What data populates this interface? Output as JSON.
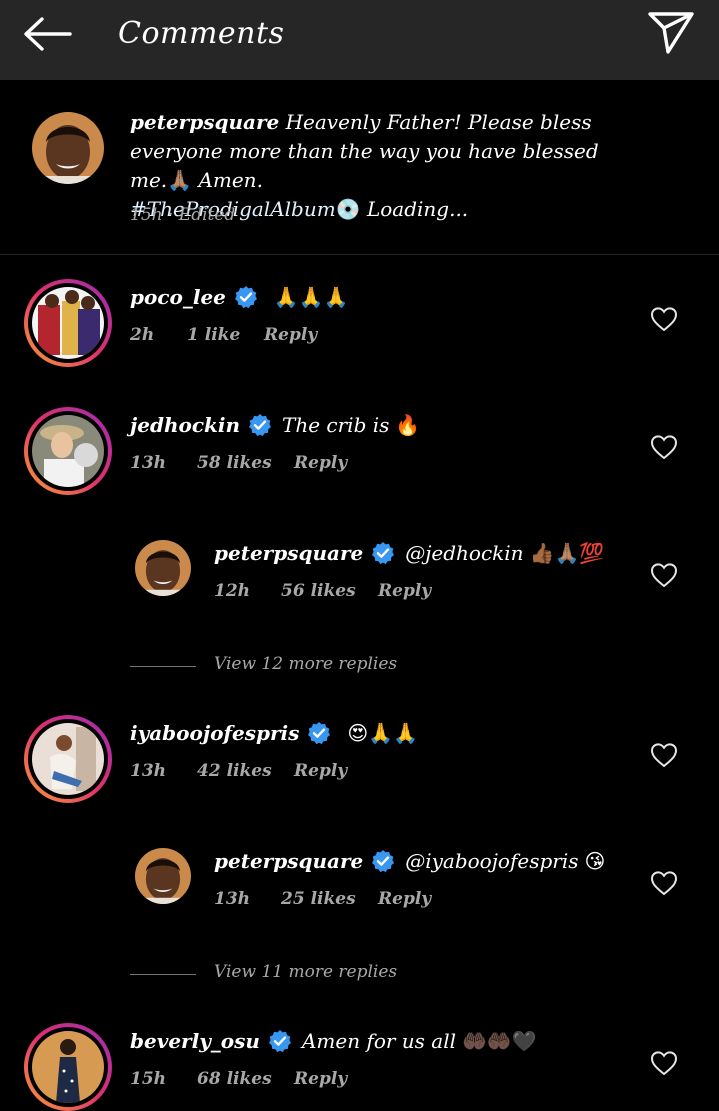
{
  "header": {
    "title": "Comments"
  },
  "caption": {
    "username": "peterpsquare",
    "text_1": "Heavenly Father! Please bless everyone",
    "text_2": "more than the way you have blessed me.",
    "emoji_pray": "🙏🏽",
    "text_amen": "Amen.",
    "hashtag": "#TheProdigalAlbum",
    "emoji_disc": "💿",
    "text_loading": "Loading...",
    "meta": "15h · Edited"
  },
  "comments": [
    {
      "username": "poco_lee",
      "text": "",
      "emoji": "🙏🙏🙏",
      "time": "2h",
      "likes": "1 like",
      "reply": "Reply"
    },
    {
      "username": "jedhockin",
      "text": "The crib is",
      "emoji": "🔥",
      "time": "13h",
      "likes": "58 likes",
      "reply": "Reply"
    },
    {
      "username": "peterpsquare",
      "text": "@jedhockin",
      "emoji": "👍🏾🙏🏽💯",
      "time": "12h",
      "likes": "56 likes",
      "reply": "Reply"
    },
    {
      "username": "iyaboojofespris",
      "text": "",
      "emoji": "😍🙏🙏",
      "time": "13h",
      "likes": "42 likes",
      "reply": "Reply"
    },
    {
      "username": "peterpsquare",
      "text": "@iyaboojofespris",
      "emoji": "😘",
      "time": "13h",
      "likes": "25 likes",
      "reply": "Reply"
    },
    {
      "username": "beverly_osu",
      "text": "Amen for us all",
      "emoji": "🤲🏿🤲🏿🖤",
      "time": "15h",
      "likes": "68 likes",
      "reply": "Reply"
    }
  ],
  "view_more": [
    "View 12 more replies",
    "View 11 more replies"
  ],
  "colors": {
    "header_bg": "#262626",
    "verified": "#3897f0",
    "meta_text": "#a8a8a8",
    "divider": "#262626"
  }
}
